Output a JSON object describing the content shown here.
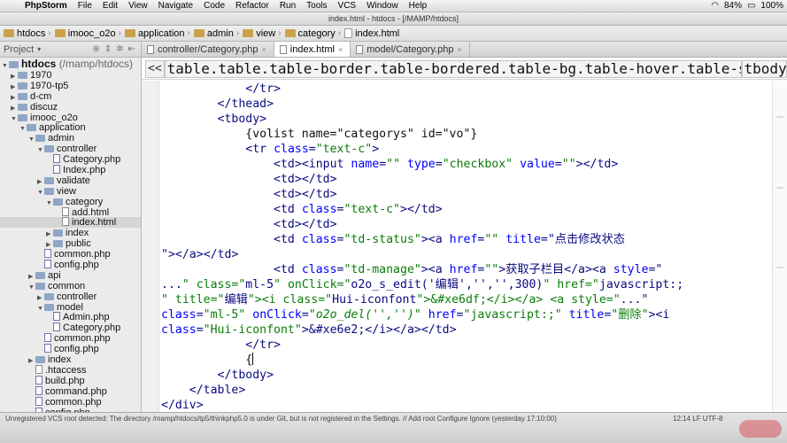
{
  "menubar": {
    "app": "PhpStorm",
    "items": [
      "File",
      "Edit",
      "View",
      "Navigate",
      "Code",
      "Refactor",
      "Run",
      "Tools",
      "VCS",
      "Window",
      "Help"
    ],
    "battery": "84%",
    "volume": "100%"
  },
  "window": {
    "title": "index.html - htdocs - [/MAMP/htdocs]"
  },
  "navbar": {
    "crumbs": [
      "htdocs",
      "imooc_o2o",
      "application",
      "admin",
      "view",
      "category",
      "index.html"
    ]
  },
  "project": {
    "label": "Project",
    "root_name": "htdocs",
    "root_path": "(/mamp/htdocs)",
    "tree": [
      {
        "label": "1970",
        "depth": 1,
        "kind": "folder",
        "open": false
      },
      {
        "label": "1970-tp5",
        "depth": 1,
        "kind": "folder",
        "open": false
      },
      {
        "label": "d-cm",
        "depth": 1,
        "kind": "folder",
        "open": false
      },
      {
        "label": "discuz",
        "depth": 1,
        "kind": "folder",
        "open": false
      },
      {
        "label": "imooc_o2o",
        "depth": 1,
        "kind": "folder",
        "open": true
      },
      {
        "label": "application",
        "depth": 2,
        "kind": "folder",
        "open": true
      },
      {
        "label": "admin",
        "depth": 3,
        "kind": "folder",
        "open": true
      },
      {
        "label": "controller",
        "depth": 4,
        "kind": "folder",
        "open": true
      },
      {
        "label": "Category.php",
        "depth": 5,
        "kind": "php"
      },
      {
        "label": "Index.php",
        "depth": 5,
        "kind": "php"
      },
      {
        "label": "validate",
        "depth": 4,
        "kind": "folder",
        "open": false
      },
      {
        "label": "view",
        "depth": 4,
        "kind": "folder",
        "open": true
      },
      {
        "label": "category",
        "depth": 5,
        "kind": "folder",
        "open": true
      },
      {
        "label": "add.html",
        "depth": 6,
        "kind": "file"
      },
      {
        "label": "index.html",
        "depth": 6,
        "kind": "file",
        "selected": true
      },
      {
        "label": "index",
        "depth": 5,
        "kind": "folder",
        "open": false
      },
      {
        "label": "public",
        "depth": 5,
        "kind": "folder",
        "open": false
      },
      {
        "label": "common.php",
        "depth": 4,
        "kind": "php"
      },
      {
        "label": "config.php",
        "depth": 4,
        "kind": "php"
      },
      {
        "label": "api",
        "depth": 3,
        "kind": "folder",
        "open": false
      },
      {
        "label": "common",
        "depth": 3,
        "kind": "folder",
        "open": true
      },
      {
        "label": "controller",
        "depth": 4,
        "kind": "folder",
        "open": false
      },
      {
        "label": "model",
        "depth": 4,
        "kind": "folder",
        "open": true
      },
      {
        "label": "Admin.php",
        "depth": 5,
        "kind": "php"
      },
      {
        "label": "Category.php",
        "depth": 5,
        "kind": "php"
      },
      {
        "label": "common.php",
        "depth": 4,
        "kind": "php"
      },
      {
        "label": "config.php",
        "depth": 4,
        "kind": "php"
      },
      {
        "label": "index",
        "depth": 3,
        "kind": "folder",
        "open": false
      },
      {
        "label": ".htaccess",
        "depth": 3,
        "kind": "file"
      },
      {
        "label": "build.php",
        "depth": 3,
        "kind": "php"
      },
      {
        "label": "command.php",
        "depth": 3,
        "kind": "php"
      },
      {
        "label": "common.php",
        "depth": 3,
        "kind": "php"
      },
      {
        "label": "config.php",
        "depth": 3,
        "kind": "php"
      }
    ]
  },
  "tabs": [
    {
      "label": "controller/Category.php",
      "active": false
    },
    {
      "label": "index.html",
      "active": true
    },
    {
      "label": "model/Category.php",
      "active": false
    }
  ],
  "tagpath": {
    "back": "<<",
    "path": "table.table.table-border.table-bordered.table-bg.table-hover.table-sort",
    "current": "tbody"
  },
  "code_lines": [
    "            </tr>",
    "        </thead>",
    "        <tbody>",
    "            {volist name=\"categorys\" id=\"vo\"}",
    "            <tr class=\"text-c\">",
    "                <td><input name=\"\" type=\"checkbox\" value=\"\"></td>",
    "                <td></td>",
    "                <td></td>",
    "                <td class=\"text-c\"></td>",
    "                <td></td>",
    "                <td class=\"td-status\"><a href=\"\" title=\"点击修改状态",
    "\"></a></td>",
    "                <td class=\"td-manage\"><a href=\"\">获取子栏目</a><a style=\"",
    "...\" class=\"ml-5\" onClick=\"o2o_s_edit('编辑','','',300)\" href=\"javascript:;",
    "\" title=\"编辑\"><i class=\"Hui-iconfont\">&#xe6df;</i></a> <a style=\"...\"",
    "class=\"ml-5\" onClick=\"o2o_del('','')\" href=\"javascript:;\" title=\"删除\"><i",
    "class=\"Hui-iconfont\">&#xe6e2;</i></a></td>",
    "            </tr>",
    "            {",
    "        </tbody>",
    "    </table>",
    "</div>"
  ],
  "statusbar": {
    "message": "Unregistered VCS root detected: The directory /mamp/htdocs/tp5/thinkphp5.0 is under Git, but is not registered in the Settings. // Add root  Configure  Ignore (yesterday 17:10:00)",
    "position": "12:14  LF  UTF-8"
  }
}
